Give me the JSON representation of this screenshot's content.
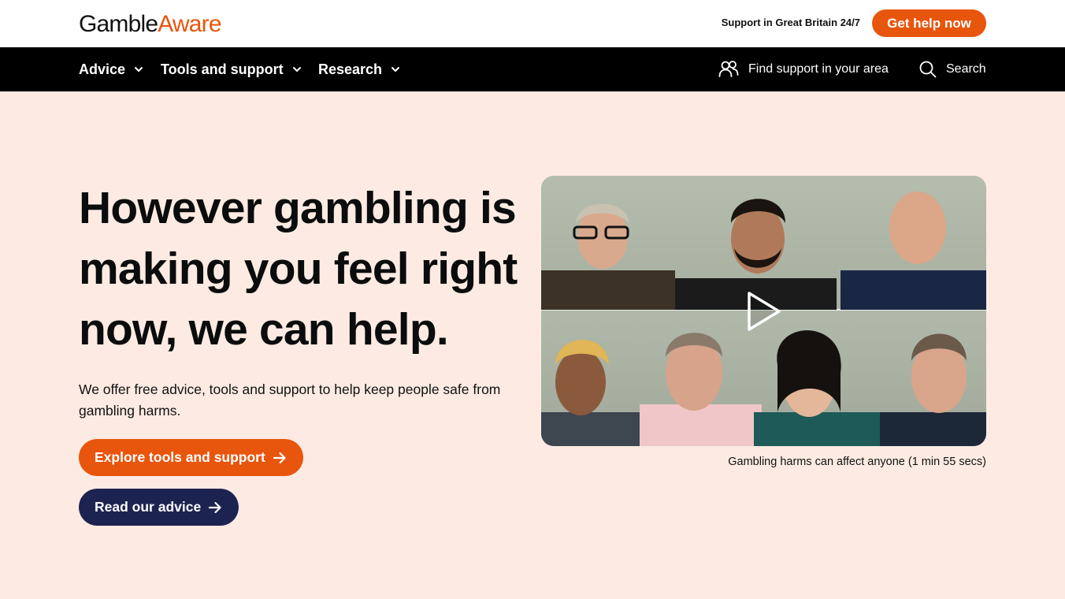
{
  "header": {
    "logo_part1": "Gamble",
    "logo_part2": "Aware",
    "support_text": "Support in Great Britain 24/7",
    "help_button": "Get help now"
  },
  "nav": {
    "items": [
      {
        "label": "Advice"
      },
      {
        "label": "Tools and support"
      },
      {
        "label": "Research"
      }
    ],
    "find_support": "Find support in your area",
    "search": "Search"
  },
  "hero": {
    "headline": "However gambling is making you feel right now, we can help.",
    "intro": "We offer free advice, tools and support to help keep people safe from gambling harms.",
    "primary_button": "Explore tools and support",
    "secondary_button": "Read our advice",
    "video_caption": "Gambling harms can affect anyone (1 min 55 secs)"
  },
  "colors": {
    "brand_orange": "#e8550d",
    "nav_black": "#000000",
    "hero_background": "#fdebe3",
    "dark_button": "#1d2351"
  },
  "icons": {
    "nav_chevron": "chevron-down-icon",
    "find_support": "people-icon",
    "search": "search-icon",
    "button_arrow": "arrow-right-icon",
    "video": "play-icon"
  }
}
